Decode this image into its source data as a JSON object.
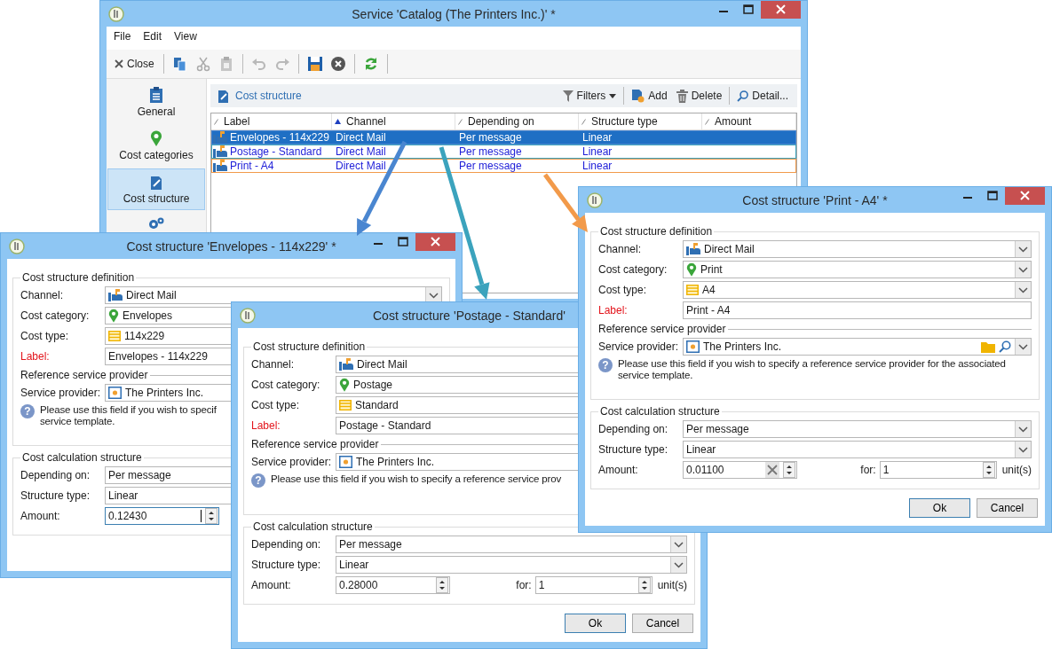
{
  "main_window": {
    "title": "Service 'Catalog (The Printers Inc.)' *",
    "menu": [
      "File",
      "Edit",
      "View"
    ],
    "toolbar": [
      {
        "kind": "close",
        "label": "Close",
        "disabled": false
      },
      {
        "kind": "separator"
      },
      {
        "kind": "copy",
        "disabled": false
      },
      {
        "kind": "cut",
        "disabled": true
      },
      {
        "kind": "paste",
        "disabled": true
      },
      {
        "kind": "separator"
      },
      {
        "kind": "undo",
        "disabled": true
      },
      {
        "kind": "redo",
        "disabled": true
      },
      {
        "kind": "separator"
      },
      {
        "kind": "save",
        "disabled": false
      },
      {
        "kind": "cancel",
        "disabled": false
      },
      {
        "kind": "separator"
      },
      {
        "kind": "refresh",
        "disabled": false
      },
      {
        "kind": "separator"
      }
    ],
    "sidebar": [
      {
        "label": "General",
        "selected": false
      },
      {
        "label": "Cost categories",
        "selected": false
      },
      {
        "label": "Cost structure",
        "selected": true
      },
      {
        "selected": false
      }
    ],
    "panel": {
      "title": "Cost structure",
      "actions": [
        {
          "kind": "filters",
          "label": "Filters"
        },
        {
          "kind": "separator"
        },
        {
          "kind": "add",
          "label": "Add"
        },
        {
          "kind": "delete",
          "label": "Delete"
        },
        {
          "kind": "separator"
        },
        {
          "kind": "detail",
          "label": "Detail..."
        }
      ]
    },
    "table": {
      "columns": [
        {
          "label": "Label",
          "sorted": false
        },
        {
          "label": "Channel",
          "sorted": true
        },
        {
          "label": "Depending on",
          "sorted": false
        },
        {
          "label": "Structure type",
          "sorted": false
        },
        {
          "label": "Amount",
          "sorted": false
        }
      ],
      "rows": [
        {
          "label": "Envelopes - 114x229",
          "channel": "Direct Mail",
          "depending_on": "Per message",
          "structure_type": "Linear",
          "selected": true,
          "color": "#4a86d0"
        },
        {
          "label": "Postage - Standard",
          "channel": "Direct Mail",
          "depending_on": "Per message",
          "structure_type": "Linear",
          "selected": false,
          "color": "#3ba3bd"
        },
        {
          "label": "Print - A4",
          "channel": "Direct Mail",
          "depending_on": "Per message",
          "structure_type": "Linear",
          "selected": false,
          "color": "#f29a4a"
        }
      ]
    }
  },
  "dialogs": [
    {
      "title": "Cost structure 'Envelopes - 114x229' *",
      "definition": {
        "heading": "Cost structure definition",
        "fields": [
          {
            "label": "Channel:",
            "value": "Direct Mail",
            "kind": "select",
            "required": false
          },
          {
            "label": "Cost category:",
            "value": "Envelopes",
            "kind": "text",
            "required": false
          },
          {
            "label": "Cost type:",
            "value": "114x229",
            "kind": "text",
            "required": false
          },
          {
            "label": "Label:",
            "value": "Envelopes - 114x229",
            "kind": "text",
            "required": true
          }
        ]
      },
      "provider": {
        "heading": "Reference service provider",
        "label": "Service provider:",
        "value": "The Printers Inc.",
        "kind": "text",
        "hint_icon": "?",
        "hint": [
          "Please use this field if you wish to specif",
          "service template."
        ]
      },
      "calculation": {
        "heading": "Cost calculation structure",
        "fields": [
          {
            "label": "Depending on:",
            "value": "Per message",
            "kind": "text"
          },
          {
            "label": "Structure type:",
            "value": "Linear",
            "kind": "text"
          }
        ],
        "amount": {
          "label": "Amount:",
          "value": "0.12430",
          "focused": true,
          "clearable": false
        }
      }
    },
    {
      "title": "Cost structure 'Postage - Standard'",
      "definition": {
        "heading": "Cost structure definition",
        "fields": [
          {
            "label": "Channel:",
            "value": "Direct Mail",
            "kind": "text",
            "required": false
          },
          {
            "label": "Cost category:",
            "value": "Postage",
            "kind": "text",
            "required": false
          },
          {
            "label": "Cost type:",
            "value": "Standard",
            "kind": "text",
            "required": false
          },
          {
            "label": "Label:",
            "value": "Postage - Standard",
            "kind": "text",
            "required": true
          }
        ]
      },
      "provider": {
        "heading": "Reference service provider",
        "label": "Service provider:",
        "value": "The Printers Inc.",
        "kind": "text",
        "hint_icon": "?",
        "hint": [
          "Please use this field if you wish to specify a reference service prov"
        ]
      },
      "calculation": {
        "heading": "Cost calculation structure",
        "fields": [
          {
            "label": "Depending on:",
            "value": "Per message",
            "kind": "select"
          },
          {
            "label": "Structure type:",
            "value": "Linear",
            "kind": "select"
          }
        ],
        "amount": {
          "label": "Amount:",
          "value": "0.28000",
          "focused": false,
          "clearable": false,
          "for_label": "for:",
          "for_value": "1",
          "unit": "unit(s)"
        }
      },
      "buttons": [
        {
          "label": "Ok",
          "default": true
        },
        {
          "label": "Cancel",
          "default": false
        }
      ]
    },
    {
      "title": "Cost structure 'Print - A4' *",
      "definition": {
        "heading": "Cost structure definition",
        "fields": [
          {
            "label": "Channel:",
            "value": "Direct Mail",
            "kind": "select",
            "required": false
          },
          {
            "label": "Cost category:",
            "value": "Print",
            "kind": "select",
            "required": false
          },
          {
            "label": "Cost type:",
            "value": "A4",
            "kind": "select",
            "required": false
          },
          {
            "label": "Label:",
            "value": "Print - A4",
            "kind": "text",
            "required": true
          }
        ]
      },
      "provider": {
        "heading": "Reference service provider",
        "label": "Service provider:",
        "value": "The Printers Inc.",
        "kind": "select",
        "lookup": true,
        "hint_icon": "?",
        "hint": [
          "Please use this field if you wish to specify a reference service provider for the associated",
          "service template."
        ]
      },
      "calculation": {
        "heading": "Cost calculation structure",
        "fields": [
          {
            "label": "Depending on:",
            "value": "Per message",
            "kind": "select"
          },
          {
            "label": "Structure type:",
            "value": "Linear",
            "kind": "select"
          }
        ],
        "amount": {
          "label": "Amount:",
          "value": "0.01100",
          "focused": false,
          "clearable": true,
          "for_label": "for:",
          "for_value": "1",
          "unit": "unit(s)"
        }
      },
      "buttons": [
        {
          "label": "Ok",
          "default": true
        },
        {
          "label": "Cancel",
          "default": false
        }
      ]
    }
  ]
}
